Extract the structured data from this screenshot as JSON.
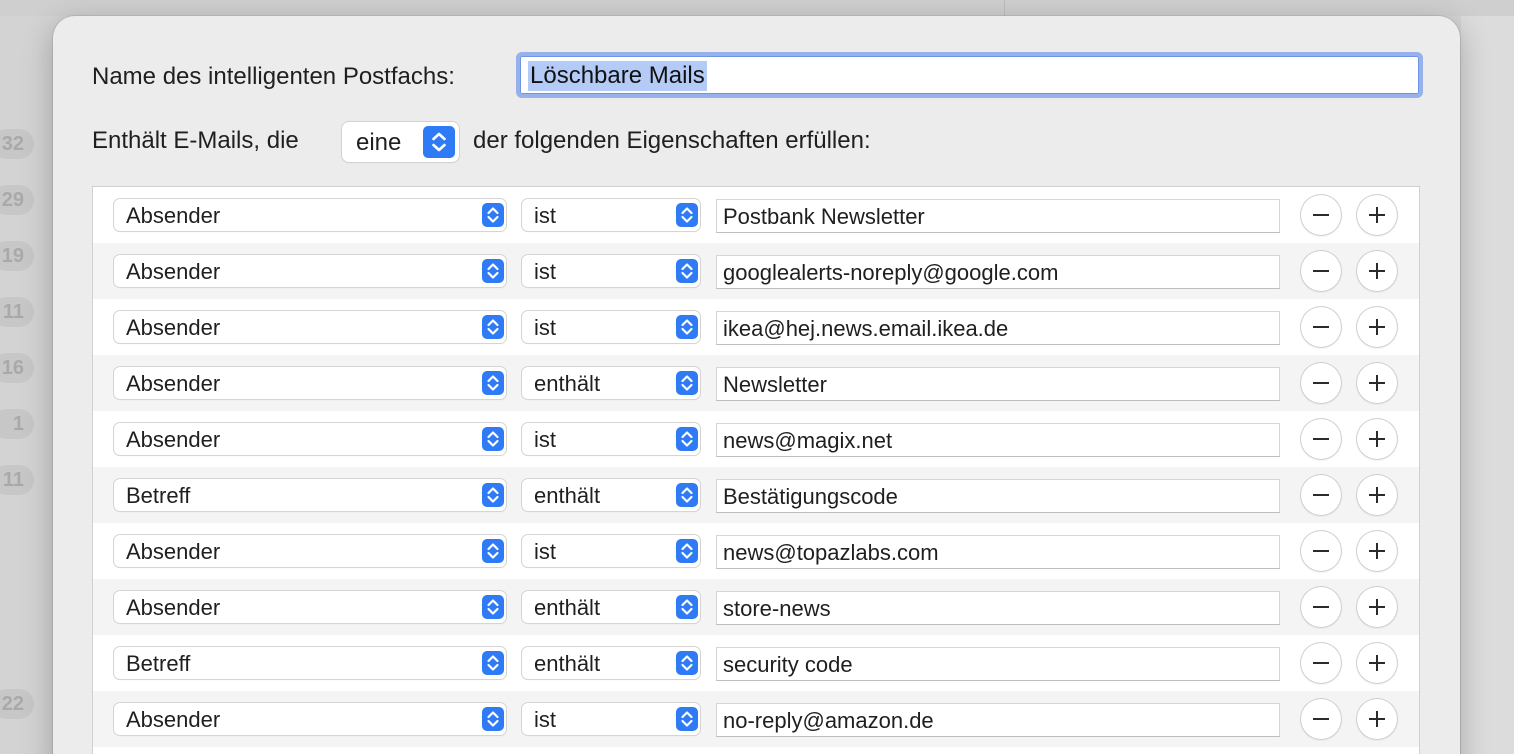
{
  "background": {
    "counts": [
      "32",
      "29",
      "19",
      "11",
      "16",
      "1",
      "11",
      "22"
    ]
  },
  "dialog": {
    "name_label": "Name des intelligenten Postfachs:",
    "name_value": "Löschbare Mails",
    "contains_label": "Enthält E-Mails, die",
    "scope_value": "eine",
    "after_label": "der folgenden Eigenschaften erfüllen:"
  },
  "rules": [
    {
      "field": "Absender",
      "operator": "ist",
      "value": "Postbank Newsletter"
    },
    {
      "field": "Absender",
      "operator": "ist",
      "value": "googlealerts-noreply@google.com"
    },
    {
      "field": "Absender",
      "operator": "ist",
      "value": "ikea@hej.news.email.ikea.de"
    },
    {
      "field": "Absender",
      "operator": "enthält",
      "value": "Newsletter"
    },
    {
      "field": "Absender",
      "operator": "ist",
      "value": "news@magix.net"
    },
    {
      "field": "Betreff",
      "operator": "enthält",
      "value": "Bestätigungscode"
    },
    {
      "field": "Absender",
      "operator": "ist",
      "value": "news@topazlabs.com"
    },
    {
      "field": "Absender",
      "operator": "enthält",
      "value": "store-news"
    },
    {
      "field": "Betreff",
      "operator": "enthält",
      "value": "security code"
    },
    {
      "field": "Absender",
      "operator": "ist",
      "value": "no-reply@amazon.de"
    }
  ],
  "colors": {
    "accent": "#2f7bf5",
    "selection": "#b3cbf6",
    "focus_ring": "#97b1ea"
  },
  "icons": {
    "stepper": "chevron-up-down-icon",
    "remove": "minus-icon",
    "add": "plus-icon"
  }
}
